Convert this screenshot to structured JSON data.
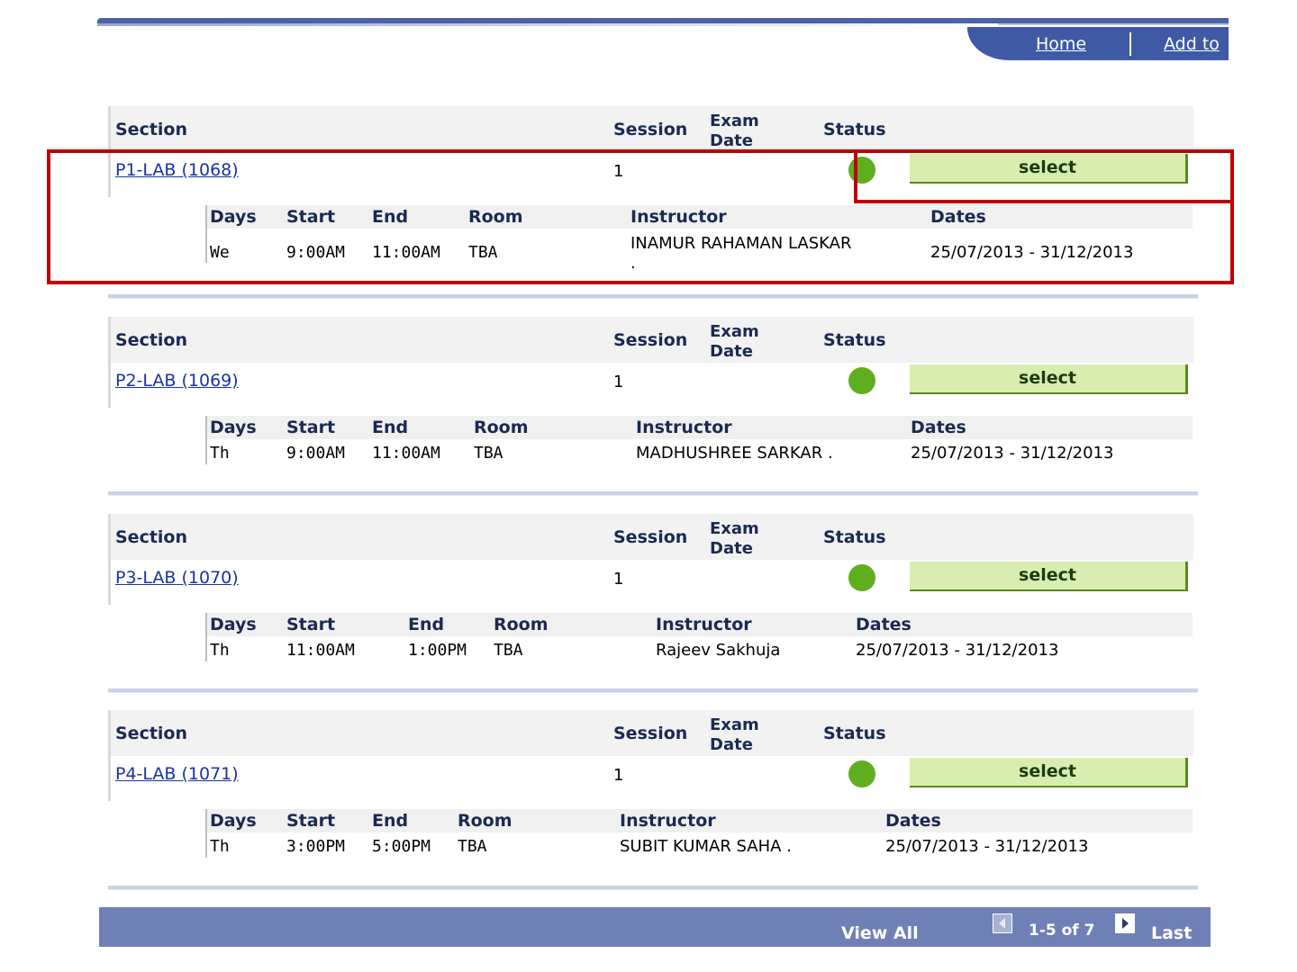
{
  "nav": {
    "home": "Home",
    "add_to": "Add to"
  },
  "headers": {
    "section": "Section",
    "session": "Session",
    "exam_line1": "Exam",
    "exam_line2": "Date",
    "status": "Status",
    "days": "Days",
    "start": "Start",
    "end": "End",
    "room": "Room",
    "instructor": "Instructor",
    "dates": "Dates"
  },
  "sections": [
    {
      "name": "P1-LAB (1068)",
      "session": "1",
      "status": "open",
      "button": "select",
      "days": "We",
      "start": "9:00AM",
      "end": "11:00AM",
      "room": "TBA",
      "instructor": "INAMUR RAHAMAN LASKAR",
      "instructor_line2": ".",
      "dates": "25/07/2013 - 31/12/2013"
    },
    {
      "name": "P2-LAB (1069)",
      "session": "1",
      "status": "open",
      "button": "select",
      "days": "Th",
      "start": "9:00AM",
      "end": "11:00AM",
      "room": "TBA",
      "instructor": "MADHUSHREE SARKAR .",
      "dates": "25/07/2013 - 31/12/2013"
    },
    {
      "name": "P3-LAB (1070)",
      "session": "1",
      "status": "open",
      "button": "select",
      "days": "Th",
      "start": "11:00AM",
      "end": "1:00PM",
      "room": "TBA",
      "instructor": "Rajeev Sakhuja",
      "dates": "25/07/2013 - 31/12/2013"
    },
    {
      "name": "P4-LAB (1071)",
      "session": "1",
      "status": "open",
      "button": "select",
      "days": "Th",
      "start": "3:00PM",
      "end": "5:00PM",
      "room": "TBA",
      "instructor": "SUBIT KUMAR SAHA .",
      "dates": "25/07/2013 - 31/12/2013"
    }
  ],
  "footer": {
    "view_all": "View All",
    "count": "1-5 of 7",
    "last": "Last"
  },
  "colors": {
    "status_open": "#5fae1f",
    "highlight": "#c00000",
    "header_blue": "#3f5aa4",
    "select_button": "#d8eeb0"
  }
}
